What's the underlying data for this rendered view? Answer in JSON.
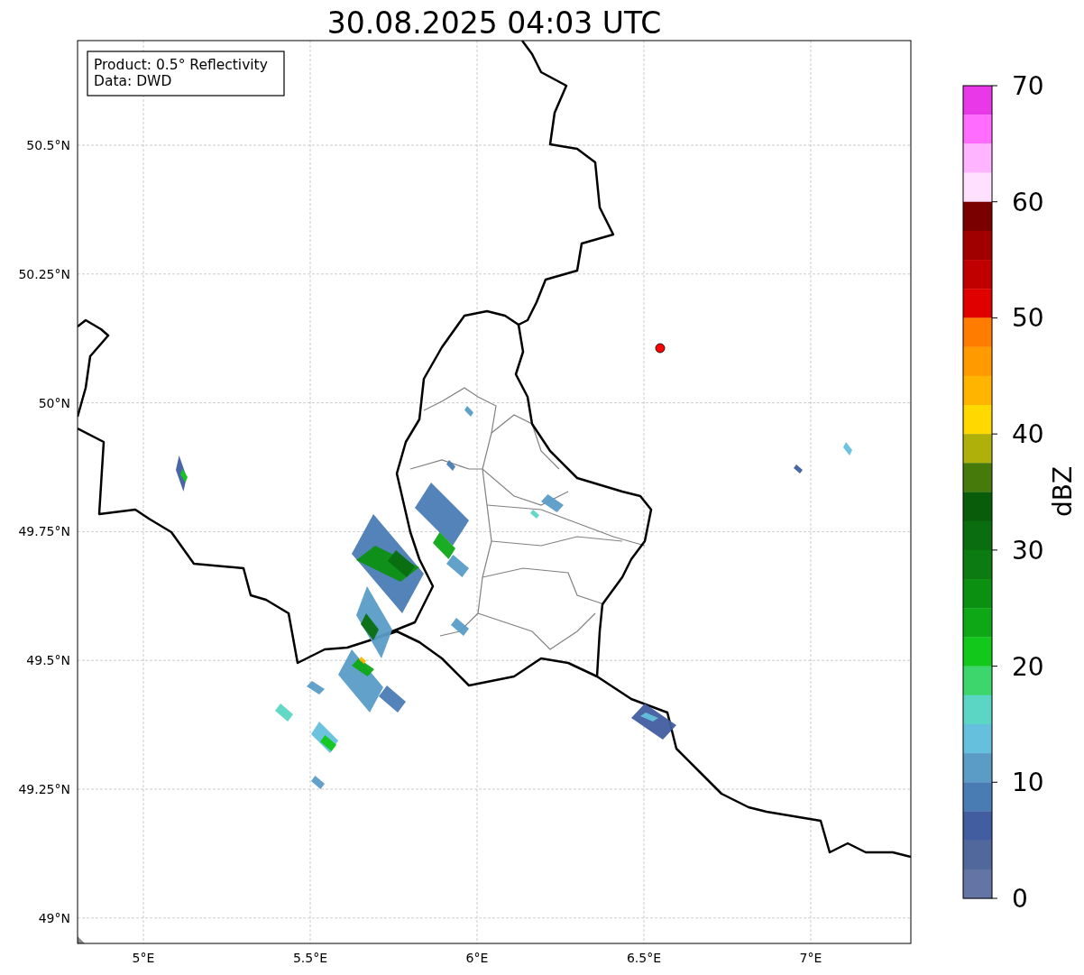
{
  "title": "30.08.2025 04:03 UTC",
  "info_box": [
    "Product: 0.5° Reflectivity",
    "Data: DWD"
  ],
  "map": {
    "lat_labels": [
      "50.5°N",
      "50.25°N",
      "50°N",
      "49.75°N",
      "49.5°N",
      "49.25°N",
      "49°N"
    ],
    "lon_labels": [
      "5°E",
      "5.5°E",
      "6°E",
      "6.5°E",
      "7°E"
    ]
  },
  "colorbar": {
    "label": "dBZ",
    "ticks": [
      "70",
      "60",
      "50",
      "40",
      "30",
      "20",
      "10",
      "0"
    ],
    "bins": [
      {
        "color": "#e838e8"
      },
      {
        "color": "#ff6cff"
      },
      {
        "color": "#ffb4ff"
      },
      {
        "color": "#ffe0ff"
      },
      {
        "color": "#7a0000"
      },
      {
        "color": "#a00000"
      },
      {
        "color": "#c00000"
      },
      {
        "color": "#e00000"
      },
      {
        "color": "#ff7c00"
      },
      {
        "color": "#ff9a00"
      },
      {
        "color": "#ffb400"
      },
      {
        "color": "#ffd800"
      },
      {
        "color": "#b0b00a"
      },
      {
        "color": "#467a0a"
      },
      {
        "color": "#085c0a"
      },
      {
        "color": "#0a6e10"
      },
      {
        "color": "#0c7c12"
      },
      {
        "color": "#0c9012"
      },
      {
        "color": "#0ea816"
      },
      {
        "color": "#12c81a"
      },
      {
        "color": "#3cd66c"
      },
      {
        "color": "#5cd6c4"
      },
      {
        "color": "#64c0dc"
      },
      {
        "color": "#5a9cc6"
      },
      {
        "color": "#4a7cb4"
      },
      {
        "color": "#425ea0"
      },
      {
        "color": "#50689c"
      },
      {
        "color": "#6474a4"
      }
    ]
  }
}
